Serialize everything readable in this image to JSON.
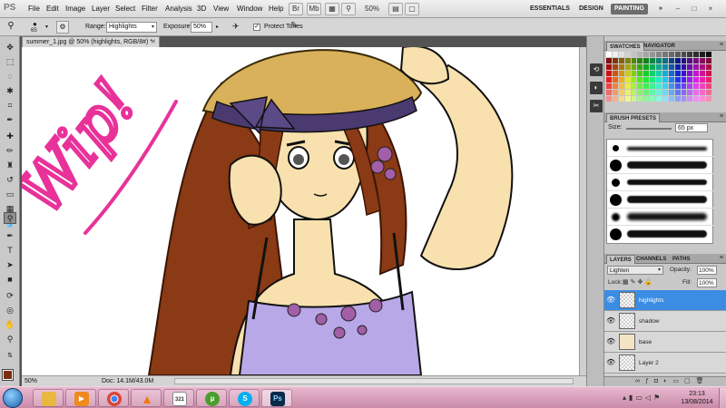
{
  "app": {
    "logo": "PS"
  },
  "menu": {
    "items": [
      "File",
      "Edit",
      "Image",
      "Layer",
      "Select",
      "Filter",
      "Analysis",
      "3D",
      "View",
      "Window",
      "Help"
    ],
    "zoom": "50%",
    "workspaces": [
      "ESSENTIALS",
      "DESIGN",
      "PAINTING"
    ],
    "active_workspace": "PAINTING",
    "overflow": "»",
    "window_controls": [
      "–",
      "□",
      "×"
    ]
  },
  "options": {
    "brush_size": "65",
    "range_label": "Range:",
    "range_value": "Highlights",
    "exposure_label": "Exposure:",
    "exposure_value": "50%",
    "protect_tones_label": "Protect Tones",
    "protect_tones_checked": true
  },
  "document": {
    "tab_title": "summer_1.jpg @ 50% (highlights, RGB/8#) *",
    "wip_text": "Wip!",
    "status_zoom": "50%",
    "status_doc": "Doc: 14.1M/43.0M"
  },
  "colors": {
    "foreground": "#7a2e10",
    "background": "#ffffff",
    "wip": "#e8329a",
    "selected_layer": "#3b8de3"
  },
  "panels": {
    "swatches_tabs": [
      "SWATCHES",
      "NAVIGATOR"
    ],
    "brush_presets_tab": "BRUSH PRESETS",
    "size_label": "Size:",
    "size_value": "65 px",
    "layers_tabs": [
      "LAYERS",
      "CHANNELS",
      "PATHS"
    ],
    "blend_mode": "Lighten",
    "opacity_label": "Opacity:",
    "opacity_value": "100%",
    "lock_label": "Lock:",
    "fill_label": "Fill:",
    "fill_value": "100%",
    "layers": [
      {
        "name": "highlights",
        "selected": true
      },
      {
        "name": "shadow",
        "selected": false
      },
      {
        "name": "base",
        "selected": false
      },
      {
        "name": "Layer 2",
        "selected": false
      }
    ]
  },
  "taskbar": {
    "apps": [
      "explorer-icon",
      "media-player-icon",
      "chrome-icon",
      "vlc-icon",
      "calendar-icon",
      "utorrent-icon",
      "skype-icon",
      "photoshop-icon"
    ],
    "calendar_label": "321",
    "photoshop_label": "Ps",
    "time": "23:13",
    "date": "13/08/2014"
  }
}
